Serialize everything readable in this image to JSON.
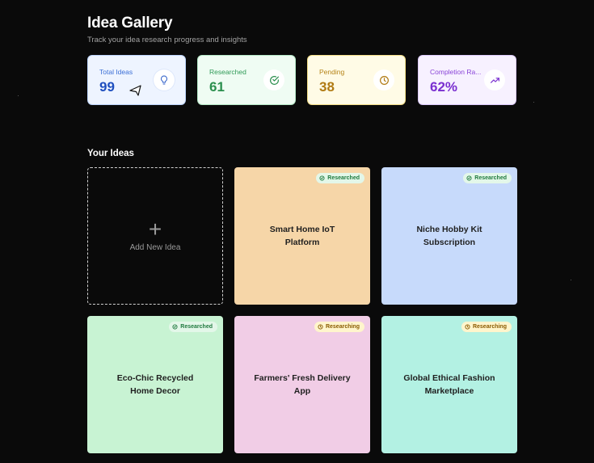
{
  "header": {
    "title": "Idea Gallery",
    "subtitle": "Track your idea research progress and insights"
  },
  "stats": [
    {
      "label": "Total Ideas",
      "value": "99",
      "icon": "lightbulb-icon",
      "color": "#1f4fbf"
    },
    {
      "label": "Researched",
      "value": "61",
      "icon": "check-circle-icon",
      "color": "#2b8f4e"
    },
    {
      "label": "Pending",
      "value": "38",
      "icon": "clock-icon",
      "color": "#b07a12"
    },
    {
      "label": "Completion Ra...",
      "value": "62%",
      "icon": "trending-up-icon",
      "color": "#7a2fd0"
    }
  ],
  "section": {
    "title": "Your Ideas"
  },
  "add_card": {
    "plus": "+",
    "label": "Add New Idea"
  },
  "ideas": [
    {
      "title": "Smart Home IoT Platform",
      "status": "Researched",
      "color": "#f6d6a8"
    },
    {
      "title": "Niche Hobby Kit Subscription",
      "status": "Researched",
      "color": "#c7dafb"
    },
    {
      "title": "Eco-Chic Recycled Home Decor",
      "status": "Researched",
      "color": "#c8f3d3"
    },
    {
      "title": "Farmers' Fresh Delivery App",
      "status": "Researching",
      "color": "#f1cde6"
    },
    {
      "title": "Global Ethical Fashion Marketplace",
      "status": "Researching",
      "color": "#b3f1e3"
    }
  ]
}
